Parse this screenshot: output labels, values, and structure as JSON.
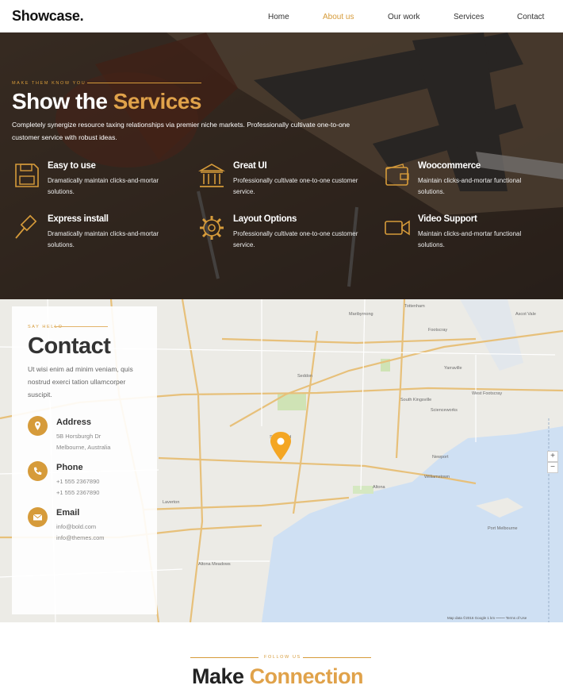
{
  "nav": {
    "logo": "Showcase.",
    "items": [
      {
        "label": "Home"
      },
      {
        "label": "About us"
      },
      {
        "label": "Our work"
      },
      {
        "label": "Services"
      },
      {
        "label": "Contact"
      }
    ],
    "active_index": 1
  },
  "hero": {
    "eyebrow": "MAKE THEM KNOW YOU",
    "title": "Show the",
    "title_accent": "Services",
    "description": "Completely synergize resource taxing relationships via premier niche markets. Professionally cultivate one-to-one customer service with robust ideas."
  },
  "features": [
    {
      "icon": "floppy-disk-icon",
      "title": "Easy to use",
      "desc": "Dramatically maintain clicks-and-mortar solutions."
    },
    {
      "icon": "bank-columns-icon",
      "title": "Great UI",
      "desc": "Professionally cultivate one-to-one customer service."
    },
    {
      "icon": "wallet-icon",
      "title": "Woocommerce",
      "desc": "Maintain clicks-and-mortar functional solutions."
    },
    {
      "icon": "gavel-icon",
      "title": "Express install",
      "desc": "Dramatically maintain clicks-and-mortar solutions."
    },
    {
      "icon": "gear-icon",
      "title": "Layout Options",
      "desc": "Professionally cultivate one-to-one customer service."
    },
    {
      "icon": "video-camera-icon",
      "title": "Video Support",
      "desc": "Maintain clicks-and-mortar functional solutions."
    }
  ],
  "contact": {
    "eyebrow": "SAY HELLO",
    "title": "Contact",
    "description": "Ut wisi enim ad minim veniam, quis nostrud exerci tation ullamcorper suscipit.",
    "address": {
      "label": "Address",
      "lines": [
        "5B Horsburgh Dr",
        "Melbourne, Australia"
      ]
    },
    "phone": {
      "label": "Phone",
      "lines": [
        "+1 555 2367890",
        "+1 555 2367890"
      ]
    },
    "email": {
      "label": "Email",
      "lines": [
        "info@bold.com",
        "info@themes.com"
      ]
    }
  },
  "map": {
    "zoom_in": "+",
    "zoom_out": "−",
    "credit": "Map data ©2016 Google   1 km ⎯⎯⎯⎯⎯   Terms of Use",
    "places": [
      "Tottenham",
      "Seddon",
      "Yarraville",
      "Footscray",
      "Kingsville",
      "Spotswood",
      "Newport",
      "Williamstown",
      "Altona",
      "Laverton",
      "Port Melbourne",
      "West Footscray",
      "Maribyrnong",
      "Ascot Vale",
      "Scienceworks",
      "Altona Meadows"
    ],
    "pin_color": "#f4a623",
    "road_color": "#e7c07a",
    "water_color": "#cfe0f3"
  },
  "follow": {
    "eyebrow": "FOLLOW US",
    "title": "Make",
    "title_accent": "Connection"
  },
  "colors": {
    "accent": "#d69b3a"
  }
}
